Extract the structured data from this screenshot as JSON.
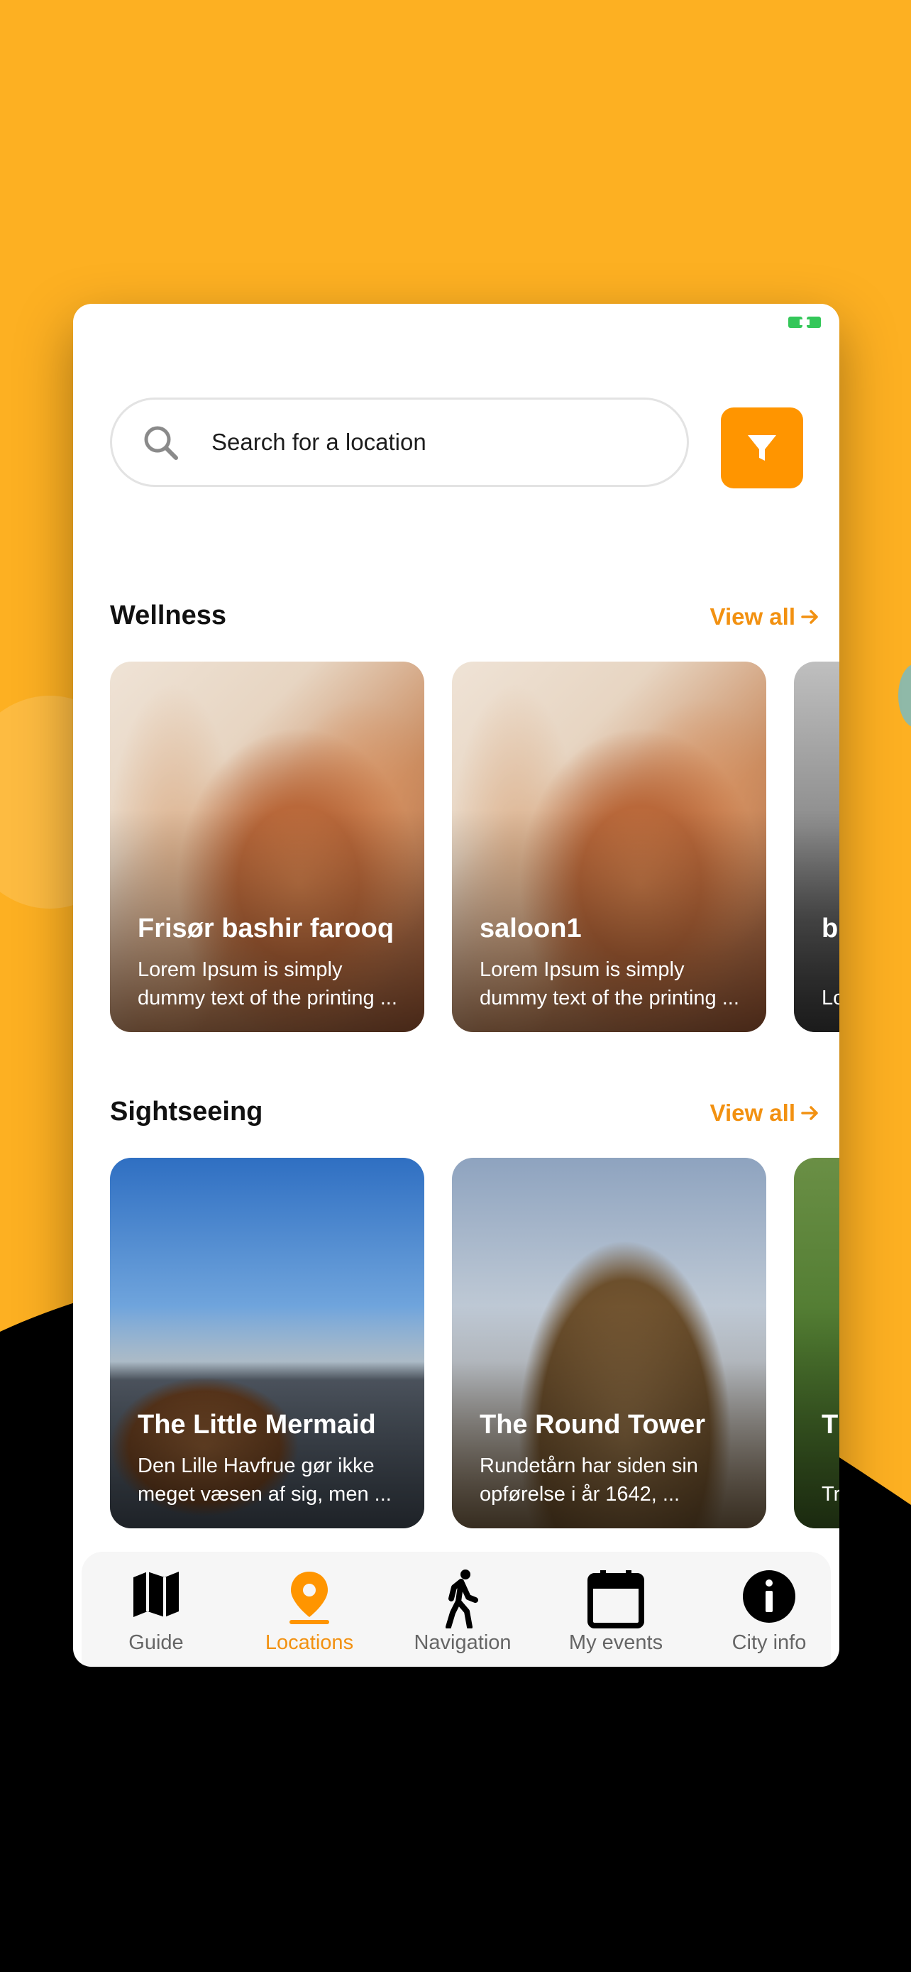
{
  "colors": {
    "background": "#FDB022",
    "accent": "#FF9500",
    "link": "#F29111",
    "dark": "#000000"
  },
  "search": {
    "placeholder": "Search for a location"
  },
  "sections": [
    {
      "title": "Wellness",
      "view_all": "View all",
      "items": [
        {
          "title": "Frisør bashir farooq",
          "desc": "Lorem Ipsum is simply dummy text of the printing ..."
        },
        {
          "title": "saloon1",
          "desc": "Lorem Ipsum is simply dummy text of the printing ..."
        },
        {
          "title": "bu zu",
          "desc": "Lo du"
        }
      ]
    },
    {
      "title": "Sightseeing",
      "view_all": "View all",
      "items": [
        {
          "title": "The Little Mermaid",
          "desc": "Den Lille Havfrue gør ikke meget væsen af sig, men ..."
        },
        {
          "title": "The Round Tower",
          "desc": "Rundetårn har siden sin opførelse i år 1642, ..."
        },
        {
          "title": "T G",
          "desc": "Tr Ko"
        }
      ]
    }
  ],
  "tabbar": [
    {
      "label": "Guide",
      "icon": "map-icon",
      "active": false
    },
    {
      "label": "Locations",
      "icon": "location-pin-icon",
      "active": true
    },
    {
      "label": "Navigation",
      "icon": "walking-person-icon",
      "active": false
    },
    {
      "label": "My events",
      "icon": "calendar-icon",
      "active": false
    },
    {
      "label": "City info",
      "icon": "info-icon",
      "active": false
    }
  ]
}
